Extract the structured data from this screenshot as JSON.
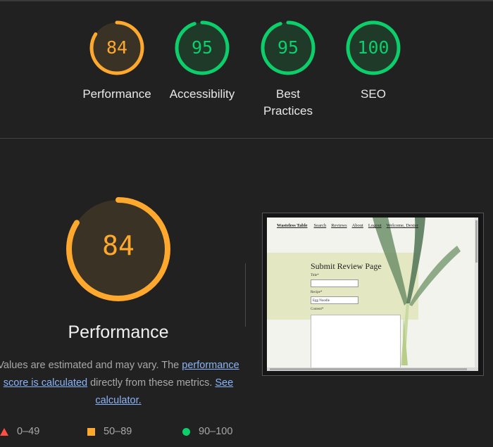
{
  "gauges": [
    {
      "score": "84",
      "label": "Performance",
      "value": 84,
      "color": "#ffa82e",
      "fill": "#3a3224"
    },
    {
      "score": "95",
      "label": "Accessibility",
      "value": 95,
      "color": "#0cce6b",
      "fill": "#1f3a28"
    },
    {
      "score": "95",
      "label": "Best Practices",
      "value": 95,
      "color": "#0cce6b",
      "fill": "#1f3a28"
    },
    {
      "score": "100",
      "label": "SEO",
      "value": 100,
      "color": "#0cce6b",
      "fill": "#1f3a28"
    }
  ],
  "main": {
    "score": "84",
    "value": 84,
    "color": "#ffa82e",
    "title": "Performance",
    "desc_prefix": "Values are estimated and may vary. The ",
    "desc_link": "performance score is calculated",
    "desc_middle": " directly from these metrics. ",
    "calc_link": "See calculator."
  },
  "legend": [
    {
      "shape": "triangle",
      "range": "0–49",
      "color": "#ff4e42"
    },
    {
      "shape": "square",
      "range": "50–89",
      "color": "#ffa82e"
    },
    {
      "shape": "circle",
      "range": "90–100",
      "color": "#0cce6b"
    }
  ],
  "screenshot": {
    "nav_brand": "Wasteless Table",
    "nav_links": [
      "Search",
      "Reviews",
      "About",
      "Logout",
      "Welcome, Dexter"
    ],
    "page_title": "Submit Review Page",
    "title_label": "Title*",
    "recipe_label": "Recipe*",
    "recipe_value": "Egg Noodle",
    "content_label": "Content*"
  }
}
